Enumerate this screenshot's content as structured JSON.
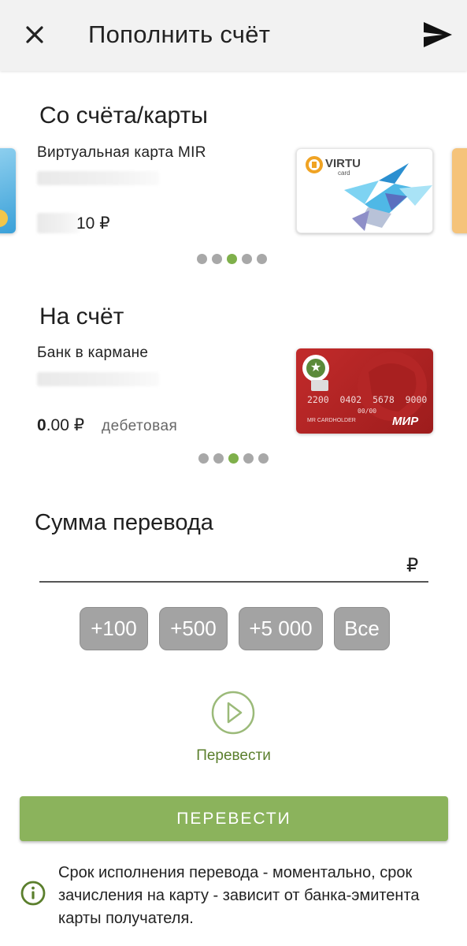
{
  "header": {
    "title": "Пополнить счёт",
    "close_icon": "close-icon",
    "send_icon": "send-icon"
  },
  "from": {
    "section_title": "Со счёта/карты",
    "account_name": "Виртуальная карта MIR",
    "balance_visible": "10 ₽",
    "card_brand": "VIRTU",
    "card_sub": "card",
    "carousel_total": 5,
    "carousel_active": 3
  },
  "to": {
    "section_title": "На счёт",
    "account_name": "Банк в кармане",
    "balance_int": "0",
    "balance_dec": ".00 ₽",
    "account_type": "дебетовая",
    "card_number": "2200  0402  5678  9000",
    "card_expiry": "00/00",
    "card_holder": "MR CARDHOLDER",
    "card_network": "МИР",
    "carousel_total": 5,
    "carousel_active": 3
  },
  "amount": {
    "section_title": "Сумма перевода",
    "value": "",
    "currency": "₽"
  },
  "quick_amounts": [
    "+100",
    "+500",
    "+5 000",
    "Все"
  ],
  "transfer_icon_label": "Перевести",
  "transfer_button": "ПЕРЕВЕСТИ",
  "info_text": "Срок исполнения перевода - моментально, срок зачисления на карту - зависит от банка-эмитента карты получателя.",
  "colors": {
    "accent_green": "#8bb35c",
    "active_dot": "#7fb04b",
    "red_card": "#b52424"
  }
}
